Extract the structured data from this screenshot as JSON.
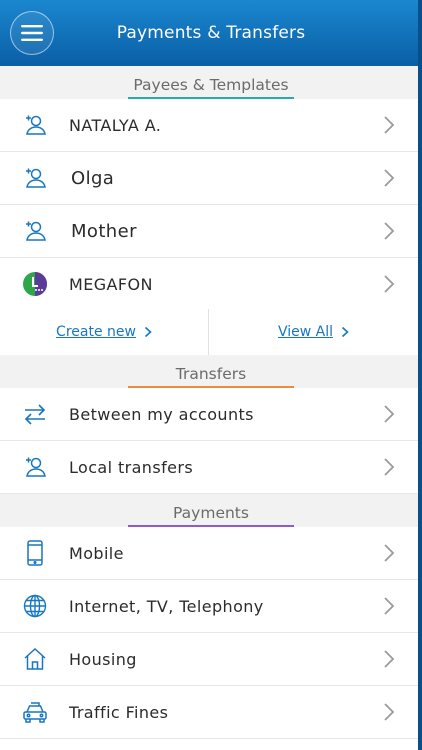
{
  "header": {
    "title": "Payments & Transfers",
    "menu_icon": "hamburger-menu-icon"
  },
  "colors": {
    "header_top": "#1a87cf",
    "header_bottom": "#0a5fa6",
    "payees_accent": "#2aa7b8",
    "transfers_accent": "#f08a3c",
    "payments_accent": "#8e5bc9",
    "icon_blue": "#1877c1",
    "megafon_green": "#2fa64a",
    "megafon_purple": "#5b3a9a"
  },
  "payees": {
    "title": "Payees & Templates",
    "items": [
      {
        "label": "NATALYA A.",
        "icon": "person-icon"
      },
      {
        "label": "Olga",
        "icon": "person-icon"
      },
      {
        "label": "Mother",
        "icon": "person-icon"
      },
      {
        "label": "MEGAFON",
        "icon": "megafon-logo-icon"
      }
    ],
    "create_new": "Create new",
    "view_all": "View All"
  },
  "transfers": {
    "title": "Transfers",
    "items": [
      {
        "label": "Between my accounts",
        "icon": "swap-arrows-icon"
      },
      {
        "label": "Local transfers",
        "icon": "person-icon"
      }
    ]
  },
  "payments": {
    "title": "Payments",
    "items": [
      {
        "label": "Mobile",
        "icon": "mobile-phone-icon"
      },
      {
        "label": "Internet, TV, Telephony",
        "icon": "globe-icon"
      },
      {
        "label": "Housing",
        "icon": "house-icon"
      },
      {
        "label": "Traffic Fines",
        "icon": "car-icon"
      }
    ]
  }
}
